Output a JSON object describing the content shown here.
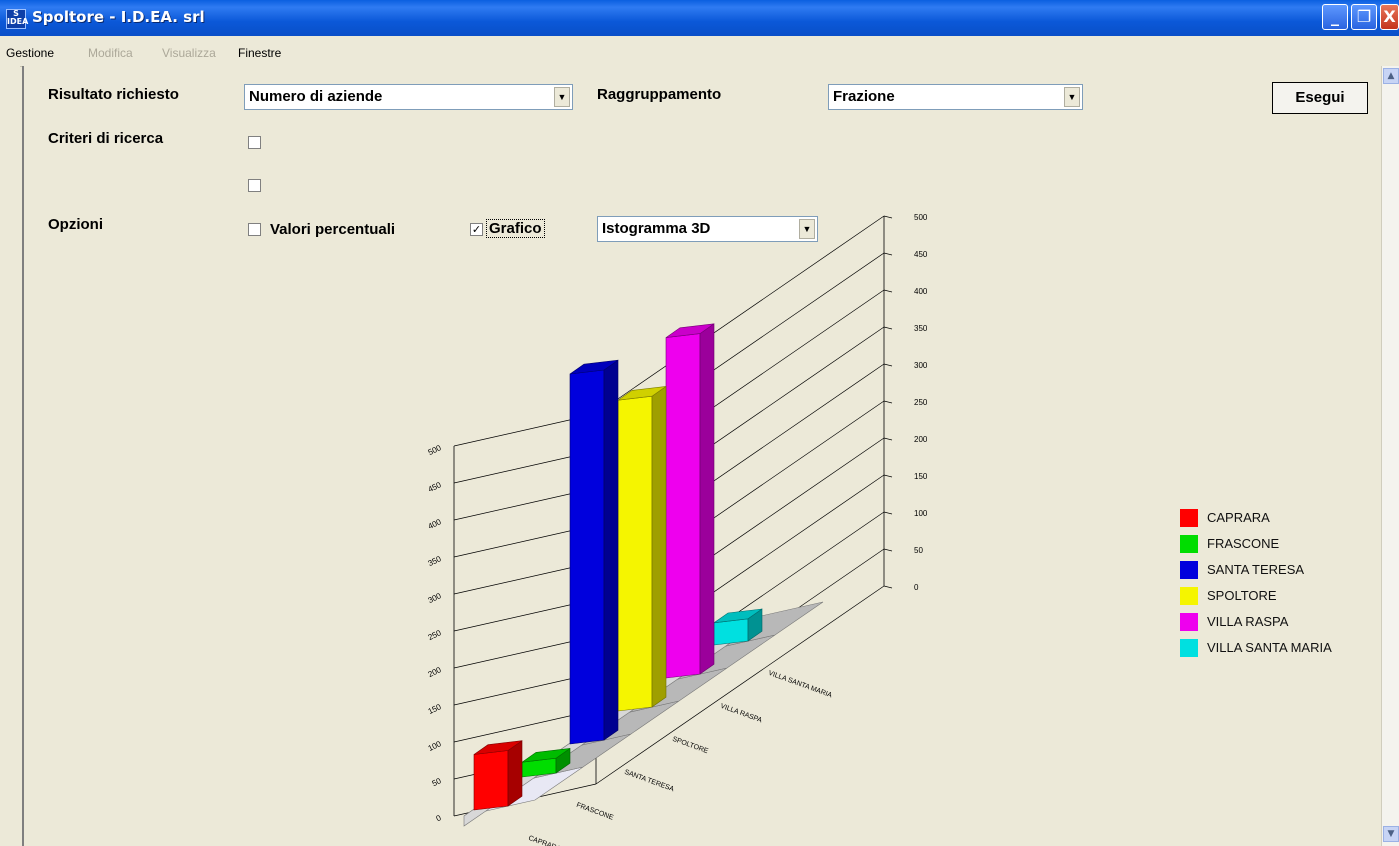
{
  "window": {
    "title": "Spoltore - I.D.EA. srl",
    "icon_text": "S\nIDEA",
    "min_glyph": "_",
    "max_glyph": "❐",
    "close_glyph": "X"
  },
  "menu": {
    "items": [
      {
        "label": "Gestione",
        "enabled": true
      },
      {
        "label": "Modifica",
        "enabled": false
      },
      {
        "label": "Visualizza",
        "enabled": false
      },
      {
        "label": "Finestre",
        "enabled": true
      }
    ]
  },
  "form": {
    "result_label": "Risultato richiesto",
    "result_value": "Numero di aziende",
    "grouping_label": "Raggruppamento",
    "grouping_value": "Frazione",
    "criteria_label": "Criteri di ricerca",
    "options_label": "Opzioni",
    "percent_label": "Valori percentuali",
    "percent_checked": false,
    "chart_label": "Grafico",
    "chart_checked": true,
    "chart_type_value": "Istogramma 3D",
    "execute_label": "Esegui",
    "dropdown_glyph": "▼",
    "check_glyph": "✓"
  },
  "chart_data": {
    "type": "bar",
    "categories": [
      "CAPRARA",
      "FRASCONE",
      "SANTA TERESA",
      "SPOLTORE",
      "VILLA RASPA",
      "VILLA SANTA MARIA"
    ],
    "values": [
      75,
      20,
      500,
      420,
      460,
      30
    ],
    "colors": [
      "#ff0000",
      "#00dd00",
      "#0000dd",
      "#f5f500",
      "#ee00ee",
      "#00e0e0"
    ],
    "ylim": [
      0,
      500
    ],
    "yticks": [
      "0",
      "50",
      "100",
      "150",
      "200",
      "250",
      "300",
      "350",
      "400",
      "450",
      "500"
    ],
    "grid": true,
    "legend_position": "right"
  },
  "legend": {
    "items": [
      "CAPRARA",
      "FRASCONE",
      "SANTA TERESA",
      "SPOLTORE",
      "VILLA RASPA",
      "VILLA SANTA MARIA"
    ]
  },
  "scroll": {
    "up_glyph": "▲",
    "down_glyph": "▼"
  }
}
